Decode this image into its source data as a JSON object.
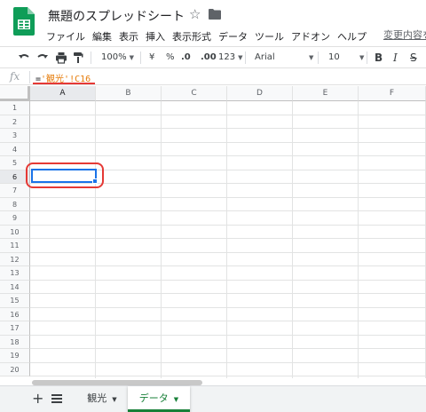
{
  "app": {
    "title": "無題のスプレッドシート",
    "last_edit_label": "変更内容を"
  },
  "menu": [
    "ファイル",
    "編集",
    "表示",
    "挿入",
    "表示形式",
    "データ",
    "ツール",
    "アドオン",
    "ヘルプ"
  ],
  "toolbar": {
    "zoom": "100%",
    "currency": "¥",
    "percent": "%",
    "decimal_decrease": ".0",
    "decimal_increase": ".00",
    "number_format": "123",
    "font": "Arial",
    "font_size": "10",
    "bold": "B",
    "italic": "I",
    "strike": "S"
  },
  "formula_bar": {
    "fx_label": "fx",
    "prefix": "=",
    "reference": "'観光'!C16"
  },
  "grid": {
    "columns": [
      "A",
      "B",
      "C",
      "D",
      "E",
      "F"
    ],
    "rows": [
      "1",
      "2",
      "3",
      "4",
      "5",
      "6",
      "7",
      "8",
      "9",
      "10",
      "11",
      "12",
      "13",
      "14",
      "15",
      "16",
      "17",
      "18",
      "19",
      "20"
    ],
    "active_column": "A",
    "active_row": "6"
  },
  "sheets": {
    "add_label": "+",
    "tabs": [
      {
        "label": "観光",
        "active": false
      },
      {
        "label": "データ",
        "active": true
      }
    ]
  },
  "colors": {
    "accent": "#1a73e8",
    "active_tab": "#188038",
    "annotation": "#e53935",
    "formula_ref": "#e67c0a"
  }
}
